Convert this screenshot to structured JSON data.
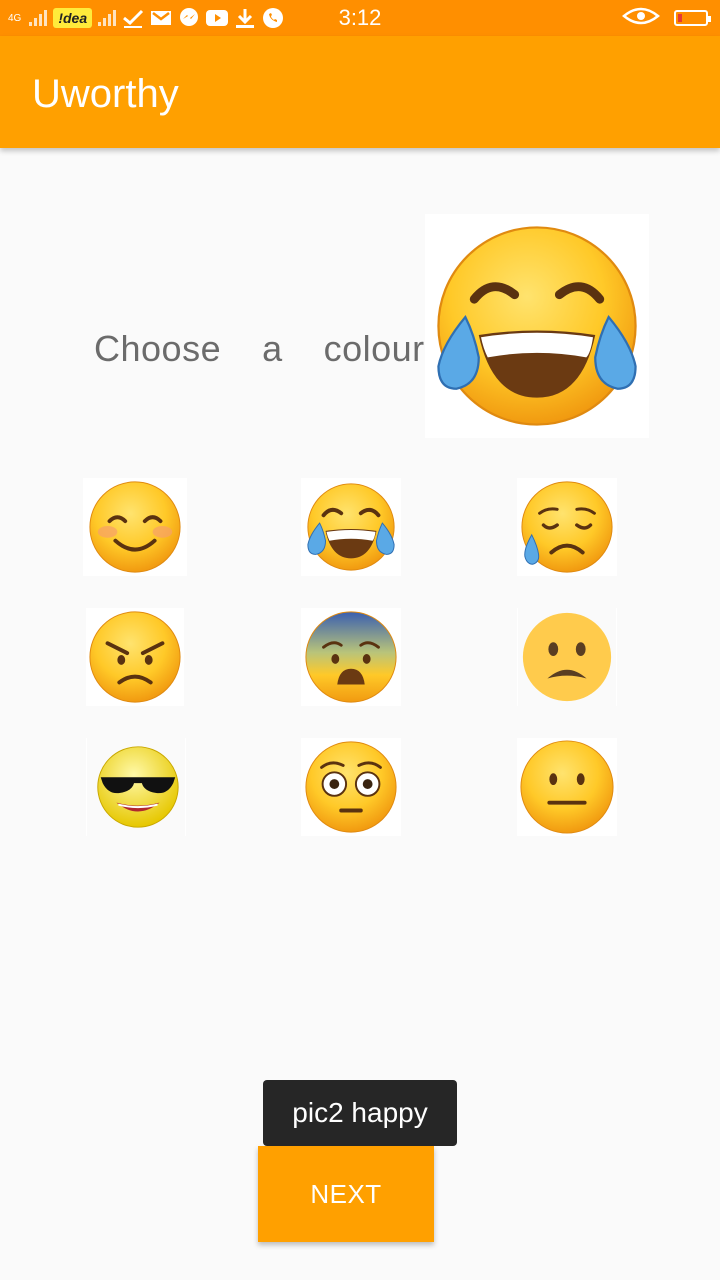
{
  "status_bar": {
    "network": "4G",
    "carrier": "!dea",
    "time": "3:12",
    "battery_level": 0.15,
    "icons": [
      "signal-icon",
      "carrier-badge",
      "signal-icon",
      "checkmark-icon",
      "gmail-icon",
      "messenger-icon",
      "youtube-icon",
      "download-icon",
      "whatsapp-icon",
      "eye-icon",
      "battery-icon"
    ]
  },
  "app_bar": {
    "title": "Uworthy"
  },
  "main": {
    "prompt": "Choose  a  colour",
    "selected_emoji": "face-with-tears-of-joy",
    "emoji_grid": [
      "smiling-face",
      "face-with-tears-of-joy",
      "sad-tear-face",
      "angry-face",
      "fearful-face",
      "frowning-face",
      "sunglasses-face",
      "flushed-face",
      "neutral-face"
    ]
  },
  "toast": {
    "text": "pic2 happy"
  },
  "footer": {
    "next_label": "NEXT"
  },
  "colors": {
    "status_bar": "#ff8f00",
    "app_bar": "#ffa000",
    "button": "#ffa000",
    "toast": "#262626"
  }
}
